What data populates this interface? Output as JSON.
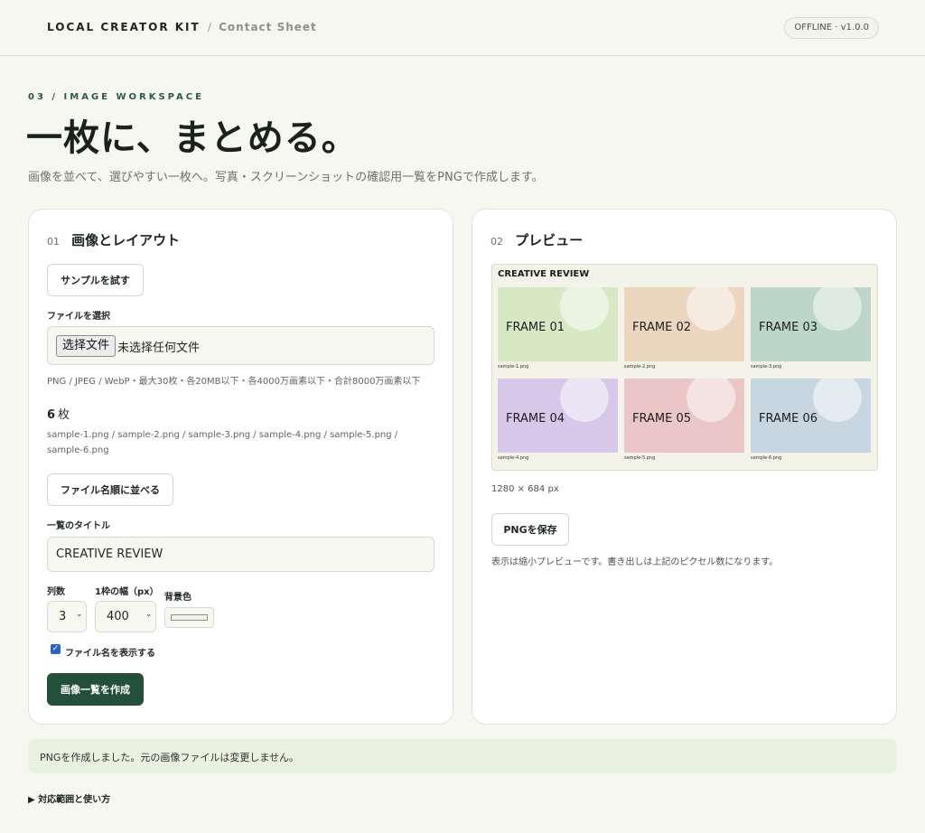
{
  "header": {
    "brand": "LOCAL CREATOR KIT",
    "separator": "/",
    "subtitle": "Contact Sheet",
    "badge": "OFFLINE · v1.0.0"
  },
  "hero": {
    "eyebrow": "03 / IMAGE WORKSPACE",
    "title": "一枚に、まとめる。",
    "description": "画像を並べて、選びやすい一枚へ。写真・スクリーンショットの確認用一覧をPNGで作成します。"
  },
  "left": {
    "num": "01",
    "title": "画像とレイアウト",
    "sample_button": "サンプルを試す",
    "file_label": "ファイルを選択",
    "file_button": "选择文件",
    "file_status": "未选择任何文件",
    "file_note": "PNG / JPEG / WebP・最大30枚・各20MB以下・各4000万画素以下・合計8000万画素以下",
    "count_value": "6",
    "count_unit": "枚",
    "file_list": "sample-1.png / sample-2.png / sample-3.png / sample-4.png / sample-5.png / sample-6.png",
    "sort_button": "ファイル名順に並べる",
    "title_label": "一覧のタイトル",
    "title_value": "CREATIVE REVIEW",
    "columns_label": "列数",
    "columns_value": "3",
    "width_label": "1枠の幅（px）",
    "width_value": "400",
    "bg_label": "背景色",
    "bg_color": "#f3f3ea",
    "show_names_label": "ファイル名を表示する",
    "show_names_checked": true,
    "create_button": "画像一覧を作成"
  },
  "right": {
    "num": "02",
    "title": "プレビュー",
    "sheet_title": "CREATIVE REVIEW",
    "frames": [
      {
        "label": "FRAME 01",
        "file": "sample-1.png",
        "color": "#d6e8c4"
      },
      {
        "label": "FRAME 02",
        "file": "sample-2.png",
        "color": "#ecd6c0"
      },
      {
        "label": "FRAME 03",
        "file": "sample-3.png",
        "color": "#bcd6c9"
      },
      {
        "label": "FRAME 04",
        "file": "sample-4.png",
        "color": "#d6c8e8"
      },
      {
        "label": "FRAME 05",
        "file": "sample-5.png",
        "color": "#eac6c6"
      },
      {
        "label": "FRAME 06",
        "file": "sample-6.png",
        "color": "#c8d6e2"
      }
    ],
    "dimensions": "1280 × 684 px",
    "save_button": "PNGを保存",
    "hint": "表示は縮小プレビューです。書き出しは上記のピクセル数になります。"
  },
  "status": "PNGを作成しました。元の画像ファイルは変更しません。",
  "disclosure": "▶ 対応範囲と使い方"
}
